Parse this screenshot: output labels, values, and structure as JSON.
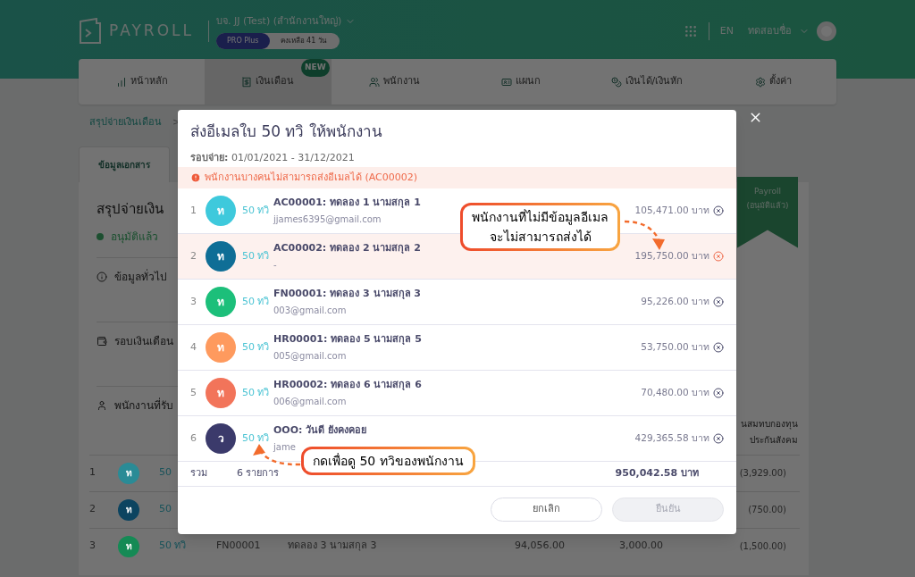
{
  "header": {
    "logo_text": "PAYROLL",
    "company": "บจ. JJ (Test) (สำนักงานใหญ่)",
    "plan": "PRO Plus",
    "remaining": "คงเหลือ 41 วัน",
    "language": "EN",
    "user": "ทดสอบชื่อ"
  },
  "nav": [
    {
      "label": "หน้าหลัก",
      "selected": false
    },
    {
      "label": "เงินเดือน",
      "selected": true,
      "badge": "NEW"
    },
    {
      "label": "พนักงาน",
      "selected": false
    },
    {
      "label": "แผนก",
      "selected": false
    },
    {
      "label": "เงินได้/เงินหัก",
      "selected": false
    },
    {
      "label": "ตั้งค่า",
      "selected": false
    }
  ],
  "breadcrumb": {
    "item": "สรุปจ่ายเงินเดือน",
    "separator": ">"
  },
  "page_tab": "ข้อมูลเอกสาร",
  "summary": {
    "title": "สรุปจ่ายเงิน",
    "status": "อนุมัติแล้ว",
    "sections": [
      {
        "label": "ข้อมูลทั่วไป"
      },
      {
        "label": "รอบเงินเดือน"
      },
      {
        "label": "พนักงานที่รับ"
      }
    ]
  },
  "ribbon": {
    "lines": [
      "Payroll",
      "(อนุมัติแล้ว)"
    ]
  },
  "background_table": {
    "column_header": [
      "นสมทบกองทุน",
      "ประกันสังคม"
    ],
    "rows": [
      {
        "number": "1",
        "avatar": "ท",
        "color": "#2a8b96",
        "link": "50",
        "column_6": "(3,929.00)"
      },
      {
        "number": "2",
        "avatar": "ท",
        "color": "#0c4460",
        "link": "50",
        "column_6": "(750.00)"
      },
      {
        "number": "3",
        "avatar": "ท",
        "color": "#158a55",
        "link": "50 ทวิ",
        "code": "FN00001",
        "name": "ทดลอง 3 นามสกุล 3",
        "column_4": "94,056.00",
        "column_5": "3,000.00",
        "column_6": "(1,500.00)"
      }
    ]
  },
  "modal": {
    "title": "ส่งอีเมลใบ 50 ทวิ ให้พนักงาน",
    "period": "**รอบจ่าย:** 01/01/2021 - 31/12/2021",
    "warning": "พนักงานบางคนไม่สามารถส่งอีเมลได้ (AC00002)",
    "rows": [
      {
        "number": "1",
        "avatar": "ท",
        "color": "#3ec9dc",
        "link": "50 ทวิ",
        "name": "AC00001: ทดลอง 1 นามสกุล 1",
        "email": "jjames6395@gmail.com",
        "amount": "105,471.00 บาท",
        "error": false
      },
      {
        "number": "2",
        "avatar": "ท",
        "color": "#0f6e96",
        "link": "50 ทวิ",
        "name": "AC00002: ทดลอง 2 นามสกุล 2",
        "email": "-",
        "amount": "195,750.00 บาท",
        "error": true
      },
      {
        "number": "3",
        "avatar": "ท",
        "color": "#1cbf7a",
        "link": "50 ทวิ",
        "name": "FN00001: ทดลอง 3 นามสกุล 3",
        "email": "003@gmail.com",
        "amount": "95,226.00 บาท",
        "error": false
      },
      {
        "number": "4",
        "avatar": "ท",
        "color": "#fe9a5e",
        "link": "50 ทวิ",
        "name": "HR00001: ทดลอง 5 นามสกุล 5",
        "email": "005@gmail.com",
        "amount": "53,750.00 บาท",
        "error": false
      },
      {
        "number": "5",
        "avatar": "ท",
        "color": "#f2745a",
        "link": "50 ทวิ",
        "name": "HR00002: ทดลอง 6 นามสกุล 6",
        "email": "006@gmail.com",
        "amount": "70,480.00 บาท",
        "error": false
      },
      {
        "number": "6",
        "avatar": "ว",
        "color": "#3b3a6b",
        "link": "50 ทวิ",
        "name": "OOO: วันดี ยังคงคอย",
        "email": "jame",
        "amount": "429,365.58 บาท",
        "error": false
      }
    ],
    "total": {
      "label": "รวม",
      "count": "6 รายการ",
      "amount": "950,042.58 บาท"
    },
    "buttons": [
      {
        "label": "ยกเลิก",
        "disabled": false
      },
      {
        "label": "ยืนยัน",
        "disabled": true
      }
    ]
  },
  "annotations": [
    {
      "lines": [
        "พนักงานที่ไม่มีข้อมูลอีเมล",
        "จะไม่สามารถส่งได้"
      ]
    },
    {
      "lines": [
        "กดเพื่อดู 50 ทวิของพนักงาน"
      ]
    }
  ]
}
